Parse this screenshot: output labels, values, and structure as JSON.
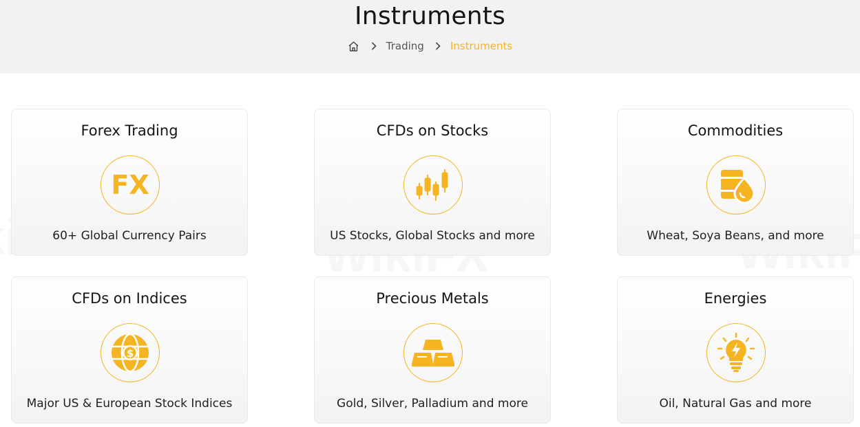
{
  "header": {
    "title": "Instruments",
    "breadcrumb": {
      "home_icon": "home-icon",
      "items": [
        "Trading",
        "Instruments"
      ]
    }
  },
  "colors": {
    "accent": "#f5b522",
    "header_bg": "#f2f2f2",
    "text": "#141414"
  },
  "cards": [
    {
      "title": "Forex Trading",
      "icon": "fx-icon",
      "description": "60+ Global Currency Pairs"
    },
    {
      "title": "CFDs on Stocks",
      "icon": "candlestick-icon",
      "description": "US Stocks, Global Stocks and more"
    },
    {
      "title": "Commodities",
      "icon": "oil-barrel-drop-icon",
      "description": "Wheat, Soya Beans, and more"
    },
    {
      "title": "CFDs on Indices",
      "icon": "globe-dollar-icon",
      "description": "Major US & European Stock Indices"
    },
    {
      "title": "Precious Metals",
      "icon": "gold-bars-icon",
      "description": "Gold, Silver, Palladium and more"
    },
    {
      "title": "Energies",
      "icon": "lightbulb-bolt-icon",
      "description": "Oil, Natural Gas and more"
    }
  ],
  "watermark": "WikiFX"
}
